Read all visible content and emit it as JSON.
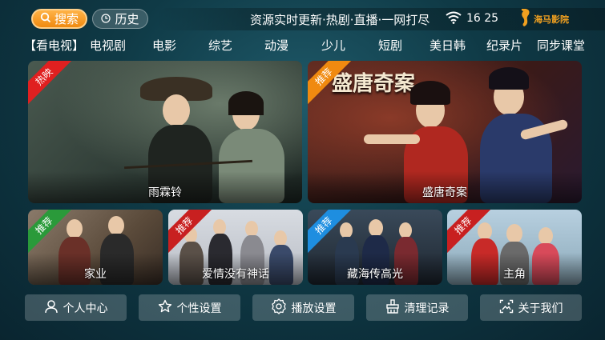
{
  "topbar": {
    "search_label": "搜索",
    "history_label": "历史",
    "marquee": "资源实时更新·热剧·直播·一网打尽",
    "time": "16 25",
    "logo_text": "海马影院"
  },
  "categories": [
    "【看电视】",
    "电视剧",
    "电影",
    "综艺",
    "动漫",
    "少儿",
    "短剧",
    "美日韩",
    "纪录片",
    "同步课堂"
  ],
  "featured": [
    {
      "title": "雨霖铃",
      "badge": "热映"
    },
    {
      "title": "盛唐奇案",
      "badge": "推荐",
      "poster_text": "盛唐奇案"
    }
  ],
  "recommended": [
    {
      "title": "家业",
      "badge": "推荐"
    },
    {
      "title": "爱情没有神话",
      "badge": "推荐"
    },
    {
      "title": "藏海传高光",
      "badge": "推荐"
    },
    {
      "title": "主角",
      "badge": "推荐"
    }
  ],
  "bottom_buttons": [
    {
      "label": "个人中心",
      "icon": "user-icon"
    },
    {
      "label": "个性设置",
      "icon": "star-icon"
    },
    {
      "label": "播放设置",
      "icon": "gear-icon"
    },
    {
      "label": "清理记录",
      "icon": "broom-icon"
    },
    {
      "label": "关于我们",
      "icon": "image-icon"
    }
  ],
  "colors": {
    "accent": "#f08a10",
    "hot_ribbon": "#e02020",
    "rec_ribbon": "#1e8ee0"
  }
}
